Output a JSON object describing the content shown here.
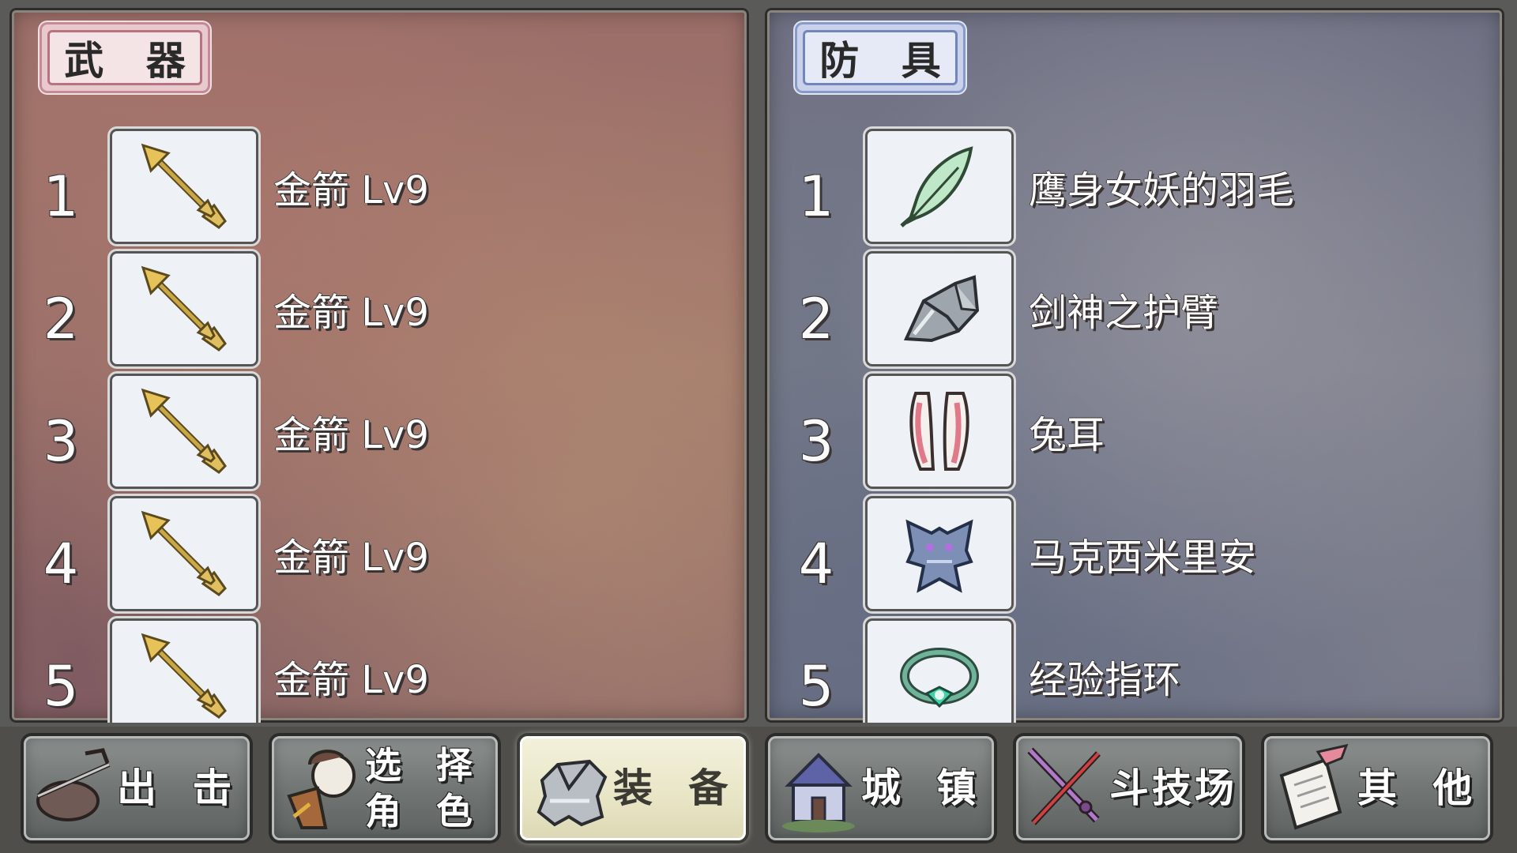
{
  "weapons_panel": {
    "title": "武 器",
    "items": [
      {
        "num": "1",
        "name": "金箭 Lv9",
        "icon": "golden-arrow-icon"
      },
      {
        "num": "2",
        "name": "金箭 Lv9",
        "icon": "golden-arrow-icon"
      },
      {
        "num": "3",
        "name": "金箭 Lv9",
        "icon": "golden-arrow-icon"
      },
      {
        "num": "4",
        "name": "金箭 Lv9",
        "icon": "golden-arrow-icon"
      },
      {
        "num": "5",
        "name": "金箭 Lv9",
        "icon": "golden-arrow-icon"
      }
    ]
  },
  "armor_panel": {
    "title": "防 具",
    "items": [
      {
        "num": "1",
        "name": "鹰身女妖的羽毛",
        "icon": "feather-icon"
      },
      {
        "num": "2",
        "name": "剑神之护臂",
        "icon": "gauntlet-icon"
      },
      {
        "num": "3",
        "name": "兔耳",
        "icon": "bunny-ears-icon"
      },
      {
        "num": "4",
        "name": "马克西米里安",
        "icon": "armor-icon"
      },
      {
        "num": "5",
        "name": "经验指环",
        "icon": "ring-icon"
      }
    ]
  },
  "bottom_menu": [
    {
      "label": "出 击",
      "icon": "sortie-icon",
      "active": false
    },
    {
      "label_line1": "选 择",
      "label_line2": "角 色",
      "icon": "character-icon",
      "active": false
    },
    {
      "label": "装 备",
      "icon": "equipment-icon",
      "active": true
    },
    {
      "label": "城 镇",
      "icon": "town-icon",
      "active": false
    },
    {
      "label": "斗技场",
      "icon": "arena-icon",
      "active": false
    },
    {
      "label": "其 他",
      "icon": "other-icon",
      "active": false
    }
  ],
  "colors": {
    "weapons_bg": "#9b6e69",
    "armor_bg": "#727587",
    "active_button": "#ecead0"
  }
}
